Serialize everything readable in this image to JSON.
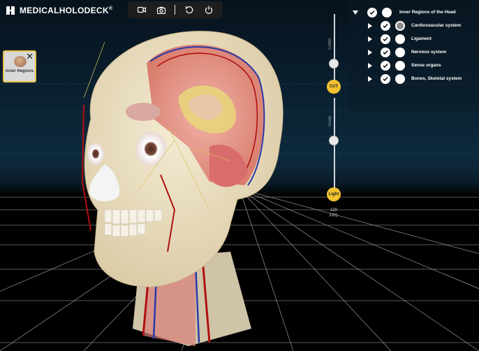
{
  "app": {
    "brand": "MEDICALHOLODECK",
    "brand_mark": "®"
  },
  "toolbar": {
    "buttons": [
      {
        "name": "video-record",
        "icon": "video-camera-icon"
      },
      {
        "name": "screenshot",
        "icon": "camera-icon"
      },
      {
        "name": "reset-view",
        "icon": "rotate-ccw-icon"
      },
      {
        "name": "power",
        "icon": "power-icon"
      }
    ]
  },
  "card": {
    "label": "Inner Regions ...",
    "close": "✕"
  },
  "controls": {
    "cutter_label": "Cutter",
    "cut_button": "CUT",
    "scale_label": "Scale",
    "light_button": "Light",
    "fps_value": "120",
    "fps_unit": "FPS"
  },
  "tree": {
    "root": {
      "label": "Inner Regions of the Head"
    },
    "children": [
      {
        "label": "Cardiovascular system",
        "color_swatch": "#8a8a8a"
      },
      {
        "label": "Ligament"
      },
      {
        "label": "Nervous system"
      },
      {
        "label": "Sense organs"
      },
      {
        "label": "Bones, Skeletal system"
      }
    ]
  },
  "colors": {
    "accent": "#f2c230",
    "card_border": "#e8c24a",
    "bg_top": "#0b2233",
    "bg_bottom": "#000000"
  }
}
